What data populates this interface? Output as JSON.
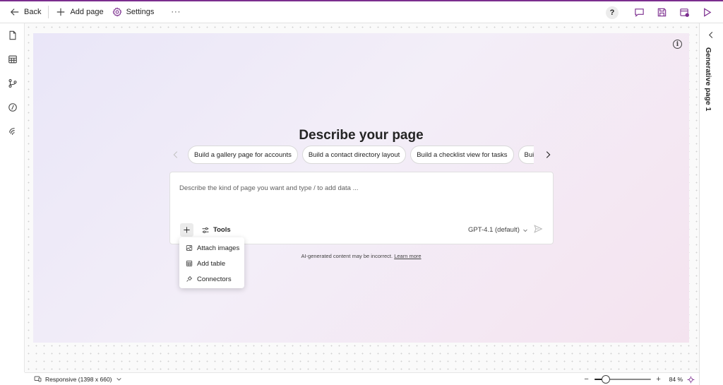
{
  "toolbar": {
    "back_label": "Back",
    "add_page_label": "Add page",
    "settings_label": "Settings",
    "more_label": "···",
    "help_label": "?"
  },
  "canvas": {
    "headline": "Describe your page",
    "suggestions": [
      "Build a gallery page for accounts",
      "Build a contact directory layout",
      "Build a checklist view for tasks",
      "Build a"
    ],
    "prompt_placeholder": "Describe the kind of page you want and type / to add data ...",
    "tools_label": "Tools",
    "model_label": "GPT-4.1 (default)",
    "disclaimer_text": "AI-generated content may be incorrect.",
    "learn_more_label": "Learn more"
  },
  "menu": {
    "items": [
      {
        "label": "Attach images",
        "icon": "image-icon"
      },
      {
        "label": "Add table",
        "icon": "table-icon"
      },
      {
        "label": "Connectors",
        "icon": "plug-icon"
      }
    ]
  },
  "right_panel": {
    "title": "Generative page 1"
  },
  "status": {
    "device_label": "Responsive (1398 x 660)",
    "zoom_minus": "−",
    "zoom_plus": "+",
    "zoom_percent": "84 %",
    "zoom_value": 0.2
  },
  "colors": {
    "accent": "#7b2d8e"
  }
}
